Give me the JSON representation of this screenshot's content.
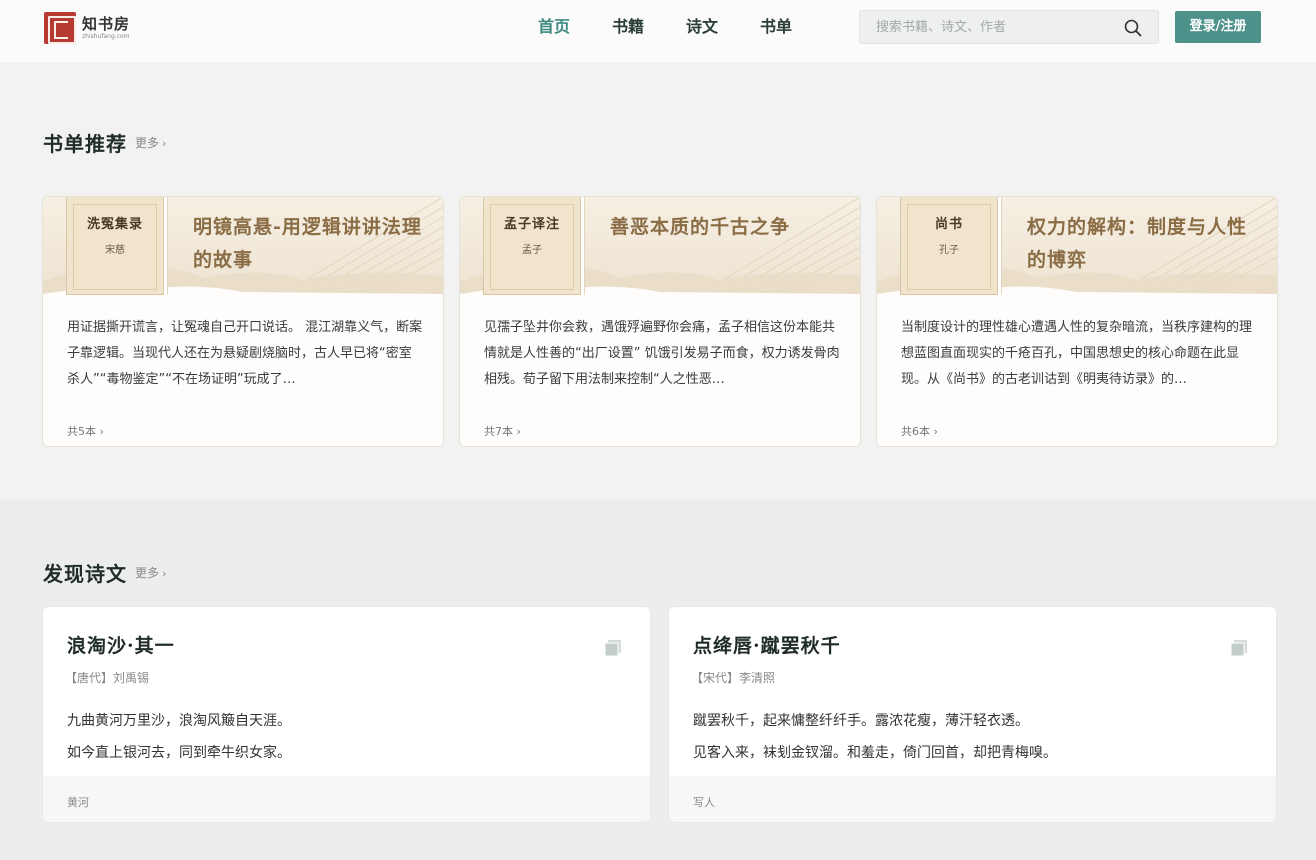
{
  "header": {
    "logo_name": "知书房",
    "logo_url": "zhishufang.com",
    "nav": [
      {
        "label": "首页",
        "active": true
      },
      {
        "label": "书籍",
        "active": false
      },
      {
        "label": "诗文",
        "active": false
      },
      {
        "label": "书单",
        "active": false
      }
    ],
    "search_placeholder": "搜索书籍、诗文、作者",
    "login_label": "登录/注册"
  },
  "booklists": {
    "title": "书单推荐",
    "more": "更多",
    "cards": [
      {
        "book_title": "洗冤集录",
        "book_author": "宋慈",
        "title": "明镜高悬-用逻辑讲讲法理的故事",
        "desc": "用证据撕开谎言，让冤魂自己开口说话。 混江湖靠义气，断案子靠逻辑。当现代人还在为悬疑剧烧脑时，古人早已将“密室杀人”“毒物鉴定”“不在场证明”玩成了…",
        "count": "共5本"
      },
      {
        "book_title": "孟子译注",
        "book_author": "孟子",
        "title": "善恶本质的千古之争",
        "desc": "见孺子坠井你会救，遇饿殍遍野你会痛，孟子相信这份本能共情就是人性善的“出厂设置” 饥饿引发易子而食，权力诱发骨肉相残。荀子留下用法制来控制“人之性恶…",
        "count": "共7本"
      },
      {
        "book_title": "尚书",
        "book_author": "孔子",
        "title": "权力的解构：制度与人性的博弈",
        "desc": "当制度设计的理性雄心遭遇人性的复杂暗流，当秩序建构的理想蓝图直面现实的千疮百孔，中国思想史的核心命题在此显现。从《尚书》的古老训诂到《明夷待访录》的…",
        "count": "共6本"
      }
    ]
  },
  "poems": {
    "title": "发现诗文",
    "more": "更多",
    "cards": [
      {
        "title": "浪淘沙·其一",
        "meta": "【唐代】刘禹锡",
        "lines": [
          "九曲黄河万里沙，浪淘风簸自天涯。",
          "如今直上银河去，同到牵牛织女家。"
        ],
        "tag": "黄河"
      },
      {
        "title": "点绛唇·蹴罢秋千",
        "meta": "【宋代】李清照",
        "lines": [
          "蹴罢秋千，起来慵整纤纤手。露浓花瘦，薄汗轻衣透。",
          "见客入来，袜刬金钗溜。和羞走，倚门回首，却把青梅嗅。"
        ],
        "tag": "写人"
      }
    ]
  },
  "colors": {
    "accent": "#4e918a",
    "nav_active": "#3e8a80",
    "card_title_gold": "#8a6c45",
    "logo_seal": "#b53a32"
  }
}
